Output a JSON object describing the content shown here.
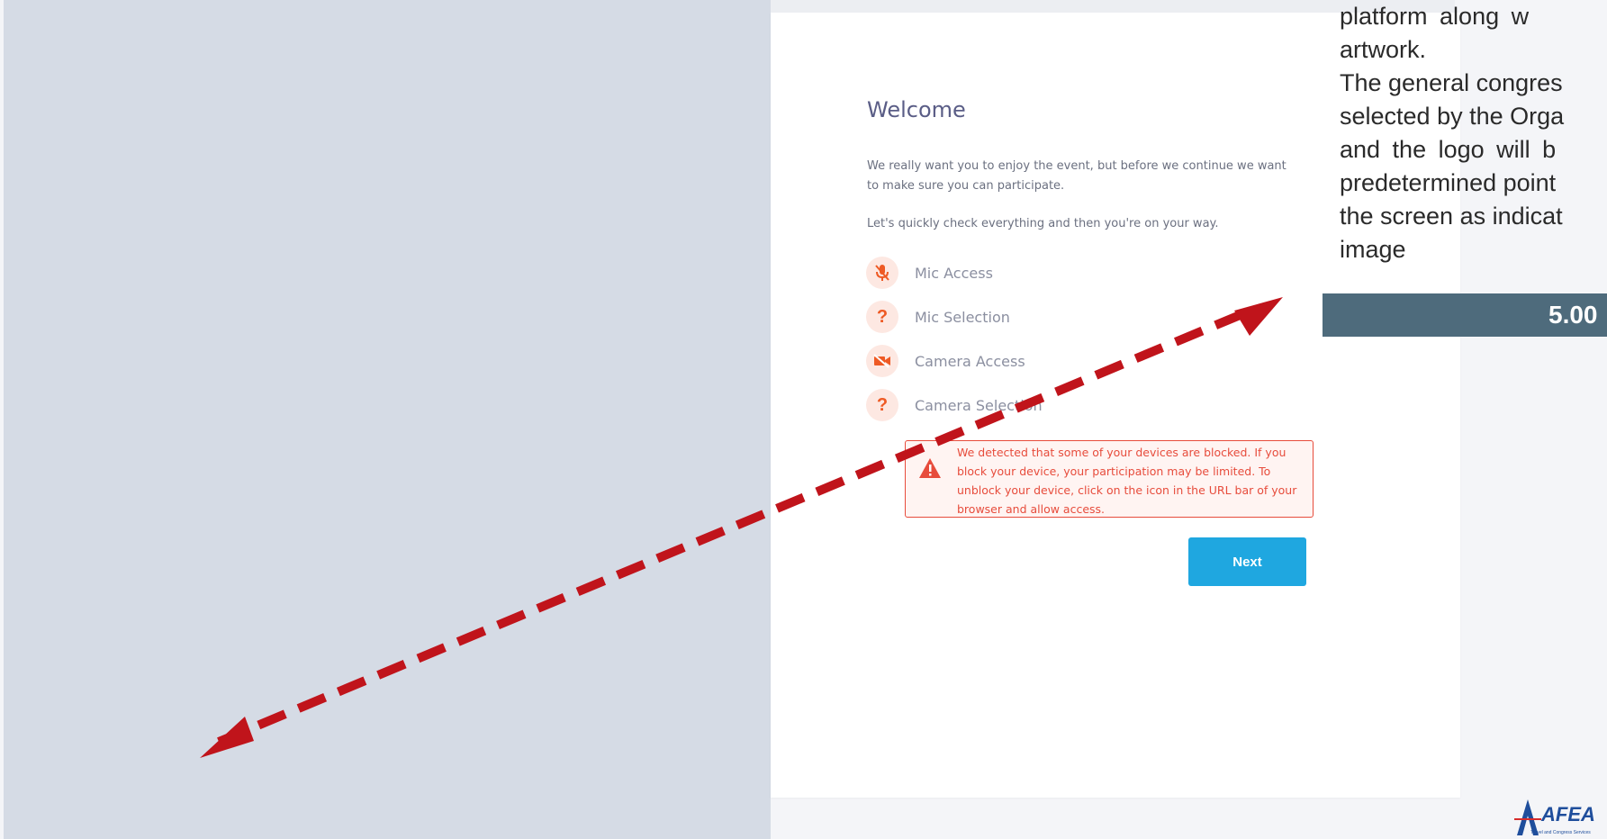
{
  "welcome": {
    "title": "Welcome",
    "intro": "We really want you to enjoy the event, but before we continue we want to make sure you can participate.",
    "subintro": "Let's quickly check everything and then you're on your way."
  },
  "checks": [
    {
      "label": "Mic Access",
      "icon": "mic-off-icon"
    },
    {
      "label": "Mic Selection",
      "icon": "question-icon"
    },
    {
      "label": "Camera Access",
      "icon": "camera-off-icon"
    },
    {
      "label": "Camera Selection",
      "icon": "question-icon"
    }
  ],
  "alert": {
    "text": "We detected that some of your devices are blocked. If you block your device, your participation may be limited. To unblock your device, click on the icon in the URL bar of your browser and allow access."
  },
  "next_button": "Next",
  "side_note": {
    "lines": [
      "platform along w",
      "artwork.",
      "The general congres",
      "selected by the Orga",
      "and the logo will b",
      "predetermined point",
      "the screen as indicat",
      "image"
    ],
    "price": "5.00"
  },
  "logo": {
    "brand": "AFEA",
    "tagline": "Travel and Congress Services"
  },
  "colors": {
    "accent": "#1fa7e0",
    "error": "#e74c3c",
    "icon_orange": "#ee5a24",
    "arrow": "#c0141b",
    "price_bar": "#4e6b7c"
  }
}
